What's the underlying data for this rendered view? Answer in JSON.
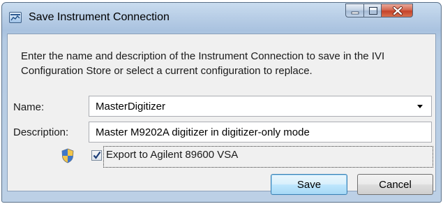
{
  "window": {
    "title": "Save Instrument Connection",
    "title_icon": "app-window-icon",
    "controls": {
      "minimize_icon": "minimize-icon",
      "maximize_icon": "maximize-icon",
      "close_icon": "close-icon"
    }
  },
  "dialog": {
    "instructions": "Enter the name and description of the Instrument Connection to save in the IVI Configuration Store or select a current configuration to replace.",
    "name": {
      "label": "Name:",
      "value": "MasterDigitizer"
    },
    "description": {
      "label": "Description:",
      "value": "Master M9202A digitizer in digitizer-only mode"
    },
    "export": {
      "label": "Export to Agilent 89600 VSA",
      "checked": true,
      "uac_icon": "uac-shield-icon"
    }
  },
  "buttons": {
    "save": "Save",
    "cancel": "Cancel"
  },
  "colors": {
    "title_gradient_top": "#c9dcef",
    "close_button": "#c4422a",
    "client_background": "#f0f0f0",
    "default_button_border": "#3c7fb1"
  }
}
